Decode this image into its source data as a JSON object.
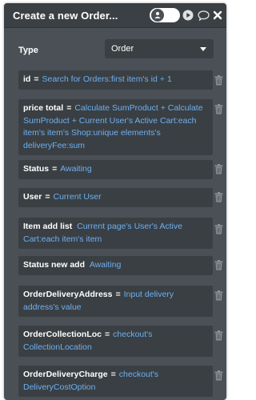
{
  "header": {
    "title": "Create a new Order...",
    "icons": [
      "toggle-icon",
      "play-icon",
      "comment-icon",
      "close-icon"
    ]
  },
  "type": {
    "label": "Type",
    "value": "Order"
  },
  "fields": [
    {
      "name": "id",
      "value": "Search for Orders:first item's id + 1"
    },
    {
      "name": "price total",
      "value": "Calculate SumProduct + Calculate SumProduct + Current User's Active Cart:each item's item's Shop:unique elements's deliveryFee:sum"
    },
    {
      "name": "Status",
      "value": "Awaiting"
    },
    {
      "name": "User",
      "value": "Current User"
    },
    {
      "name": "Item add list",
      "value": "Current page's User's Active Cart:each item's item"
    },
    {
      "name": "Status new add",
      "value": "Awaiting"
    },
    {
      "name": "OrderDeliveryAddress",
      "value": "Input delivery address's value"
    },
    {
      "name": "OrderCollectionLoc",
      "value": "checkout's CollectionLocation"
    },
    {
      "name": "OrderDeliveryCharge",
      "value": "checkout's DeliveryCostOption"
    }
  ],
  "equals": "=",
  "colors": {
    "panel_bg": "#4a5055",
    "field_bg": "#3a3f43",
    "value_text": "#6db0f2",
    "label_text": "#ffffff"
  }
}
